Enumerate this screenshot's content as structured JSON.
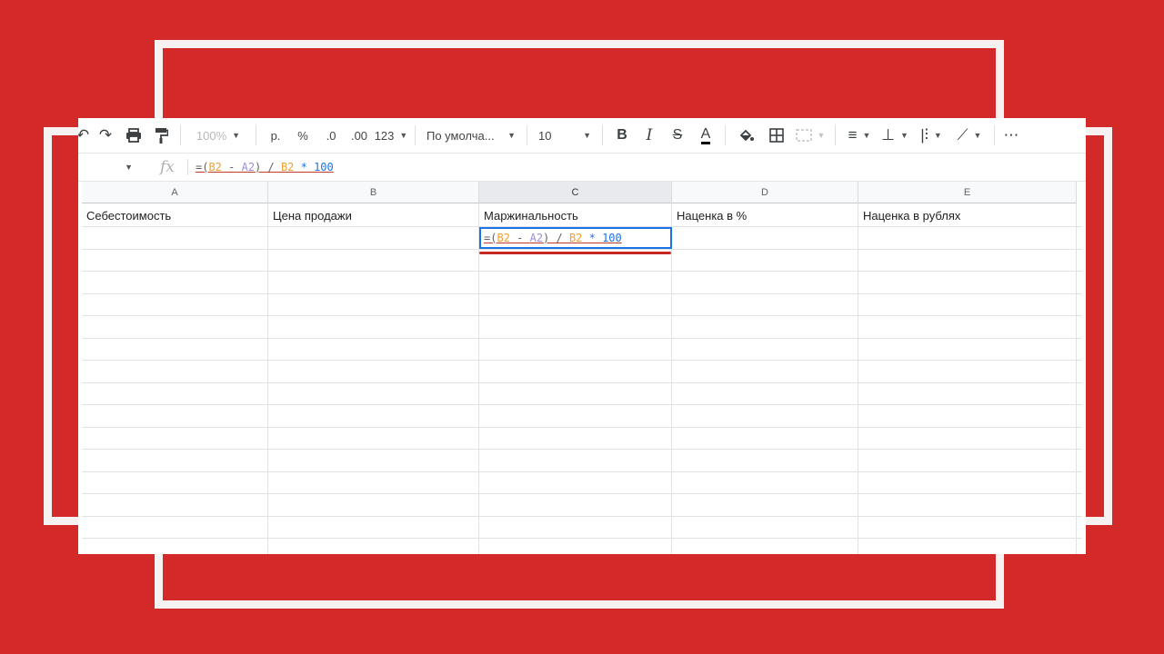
{
  "toolbar": {
    "zoom": "100%",
    "currency": "р.",
    "percent": "%",
    "dec_less": ".0",
    "dec_more": ".00",
    "format_more": "123",
    "font": "По умолча...",
    "font_size": "10",
    "bold": "B",
    "italic": "I",
    "strike": "S",
    "text_color": "A",
    "more": "⋯"
  },
  "formula_bar": {
    "fx": "fx",
    "formula_parts": [
      "=(",
      "B2",
      " - ",
      "A2",
      ") / ",
      "B2",
      " * 100"
    ]
  },
  "columns": [
    "A",
    "B",
    "C",
    "D",
    "E"
  ],
  "headers_row": [
    "Себестоимость",
    "Цена продажи",
    "Маржинальность",
    "Наценка в %",
    "Наценка в рублях"
  ],
  "active_cell": {
    "formula_parts": [
      "=(",
      "B2",
      " - ",
      "A2",
      ") / ",
      "B2",
      " * 100"
    ]
  },
  "colors": {
    "background": "#d32929",
    "frame": "#f6f2f2",
    "selection": "#1a73e8",
    "underline": "#c62828"
  }
}
